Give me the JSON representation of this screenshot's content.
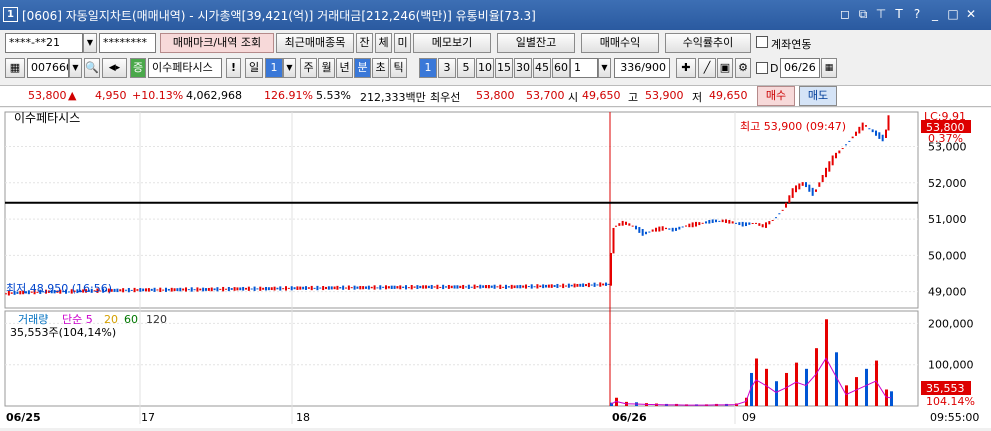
{
  "window": {
    "num": "1",
    "title": "[0606] 자동일지차트(매매내역) - 시가총액[39,421(억)] 거래대금[212,246(백만)] 유통비율[73.3]",
    "icons": [
      "restore-icon",
      "link-icon",
      "pin-icon",
      "font-icon",
      "help-icon",
      "minimize-icon",
      "maximize-icon",
      "close-icon"
    ],
    "glyphs": [
      "◻",
      "⧉",
      "⊤",
      "T",
      "?",
      "_",
      "□",
      "✕"
    ]
  },
  "toolbar1": {
    "account": "****-**21",
    "password": "********",
    "b1": "매매마크/내역 조회",
    "b2": "최근매매종목",
    "b3": "잔",
    "b4": "체",
    "b5": "미",
    "b6": "메모보기",
    "b7": "일별잔고",
    "b8": "매매수익",
    "b9": "수익률추이",
    "chk": "계좌연동"
  },
  "toolbar2": {
    "code": "007660",
    "name": "이수페타시스",
    "jeung": "증",
    "excl": "!",
    "period": "일",
    "periodnum": "1",
    "tabs": [
      "주",
      "월",
      "년",
      "분",
      "초",
      "틱"
    ],
    "mins": [
      "1",
      "3",
      "5",
      "10",
      "15",
      "30",
      "45",
      "60"
    ],
    "count": "1",
    "range": "336/900",
    "d": "D",
    "date": "06/26"
  },
  "quote": {
    "price": "53,800",
    "arrow": "▲",
    "change": "4,950",
    "rate": "+10.13%",
    "volume": "4,062,968",
    "vol_rate": "126.91%",
    "turnover": "5.53%",
    "amount": "212,333백만",
    "best_label": "최우선",
    "ask": "53,800",
    "bid": "53,700",
    "open_label": "시",
    "open": "49,650",
    "high_label": "고",
    "high": "53,900",
    "low_label": "저",
    "low": "49,650",
    "buy": "매수",
    "sell": "매도"
  },
  "chart": {
    "title": "이수페타시스",
    "high_label": "최고 53,900 (09:47)",
    "low_label": "최저 48,950 (16:56)",
    "lc_label": "LC:9.91",
    "pct_label": "0.37%",
    "cur_label": "53,800",
    "vol_title": "거래량",
    "vol_ma": [
      "단순 5",
      "20",
      "60",
      "120"
    ],
    "vol_value": "35,553주(104,14%)",
    "vol_cur": "35,553",
    "vol_pct": "104.14%",
    "xlabels": [
      "06/25",
      "17",
      "18",
      "06/26",
      "09",
      "09:55:00"
    ],
    "colors": {
      "up": "#e60000",
      "down": "#0055d4",
      "ma5": "#cc00cc",
      "ma20": "#d4a000",
      "ma60": "#007700",
      "ma120": "#333333"
    }
  },
  "chart_data": {
    "type": "candlestick",
    "price_axis": [
      "53,000",
      "52,000",
      "51,000",
      "50,000",
      "49,000"
    ],
    "price_ticks": [
      53000,
      52000,
      51000,
      50000,
      49000
    ],
    "price_range": [
      48550,
      53950
    ],
    "volume_axis": [
      "200,000",
      "100,000"
    ],
    "volume_ticks": [
      200000,
      100000
    ],
    "volume_range": [
      0,
      230000
    ],
    "reference_line": 51450,
    "price_series": [
      [
        0,
        48950
      ],
      [
        20,
        48980
      ],
      [
        40,
        49000
      ],
      [
        60,
        49000
      ],
      [
        80,
        49020
      ],
      [
        100,
        49030
      ],
      [
        120,
        49040
      ],
      [
        140,
        49050
      ],
      [
        160,
        49050
      ],
      [
        180,
        49060
      ],
      [
        200,
        49060
      ],
      [
        220,
        49070
      ],
      [
        240,
        49080
      ],
      [
        260,
        49080
      ],
      [
        280,
        49090
      ],
      [
        300,
        49100
      ],
      [
        320,
        49100
      ],
      [
        340,
        49110
      ],
      [
        360,
        49110
      ],
      [
        380,
        49120
      ],
      [
        400,
        49120
      ],
      [
        420,
        49130
      ],
      [
        440,
        49130
      ],
      [
        460,
        49130
      ],
      [
        480,
        49140
      ],
      [
        500,
        49130
      ],
      [
        520,
        49140
      ],
      [
        540,
        49150
      ],
      [
        560,
        49160
      ],
      [
        580,
        49180
      ],
      [
        600,
        49200
      ],
      [
        605,
        49220
      ],
      [
        610,
        50800
      ],
      [
        620,
        50900
      ],
      [
        630,
        50800
      ],
      [
        640,
        50600
      ],
      [
        650,
        50700
      ],
      [
        660,
        50750
      ],
      [
        670,
        50700
      ],
      [
        680,
        50800
      ],
      [
        690,
        50850
      ],
      [
        700,
        50900
      ],
      [
        710,
        50950
      ],
      [
        720,
        50950
      ],
      [
        730,
        50900
      ],
      [
        740,
        50850
      ],
      [
        750,
        50900
      ],
      [
        760,
        50800
      ],
      [
        770,
        51000
      ],
      [
        780,
        51300
      ],
      [
        790,
        51800
      ],
      [
        800,
        52000
      ],
      [
        810,
        51700
      ],
      [
        820,
        52200
      ],
      [
        830,
        52700
      ],
      [
        840,
        53000
      ],
      [
        850,
        53300
      ],
      [
        860,
        53600
      ],
      [
        870,
        53400
      ],
      [
        880,
        53200
      ],
      [
        885,
        53800
      ]
    ],
    "volume_series": [
      [
        605,
        8000
      ],
      [
        610,
        20000
      ],
      [
        620,
        10000
      ],
      [
        630,
        9000
      ],
      [
        640,
        7000
      ],
      [
        650,
        6000
      ],
      [
        660,
        5000
      ],
      [
        670,
        5000
      ],
      [
        680,
        4000
      ],
      [
        690,
        4000
      ],
      [
        700,
        4000
      ],
      [
        710,
        5000
      ],
      [
        720,
        5000
      ],
      [
        730,
        6000
      ],
      [
        740,
        20000
      ],
      [
        745,
        80000
      ],
      [
        750,
        115000
      ],
      [
        760,
        90000
      ],
      [
        770,
        60000
      ],
      [
        780,
        80000
      ],
      [
        790,
        105000
      ],
      [
        800,
        90000
      ],
      [
        810,
        140000
      ],
      [
        820,
        210000
      ],
      [
        830,
        130000
      ],
      [
        840,
        50000
      ],
      [
        850,
        70000
      ],
      [
        860,
        90000
      ],
      [
        870,
        110000
      ],
      [
        880,
        40000
      ],
      [
        885,
        35553
      ]
    ]
  }
}
